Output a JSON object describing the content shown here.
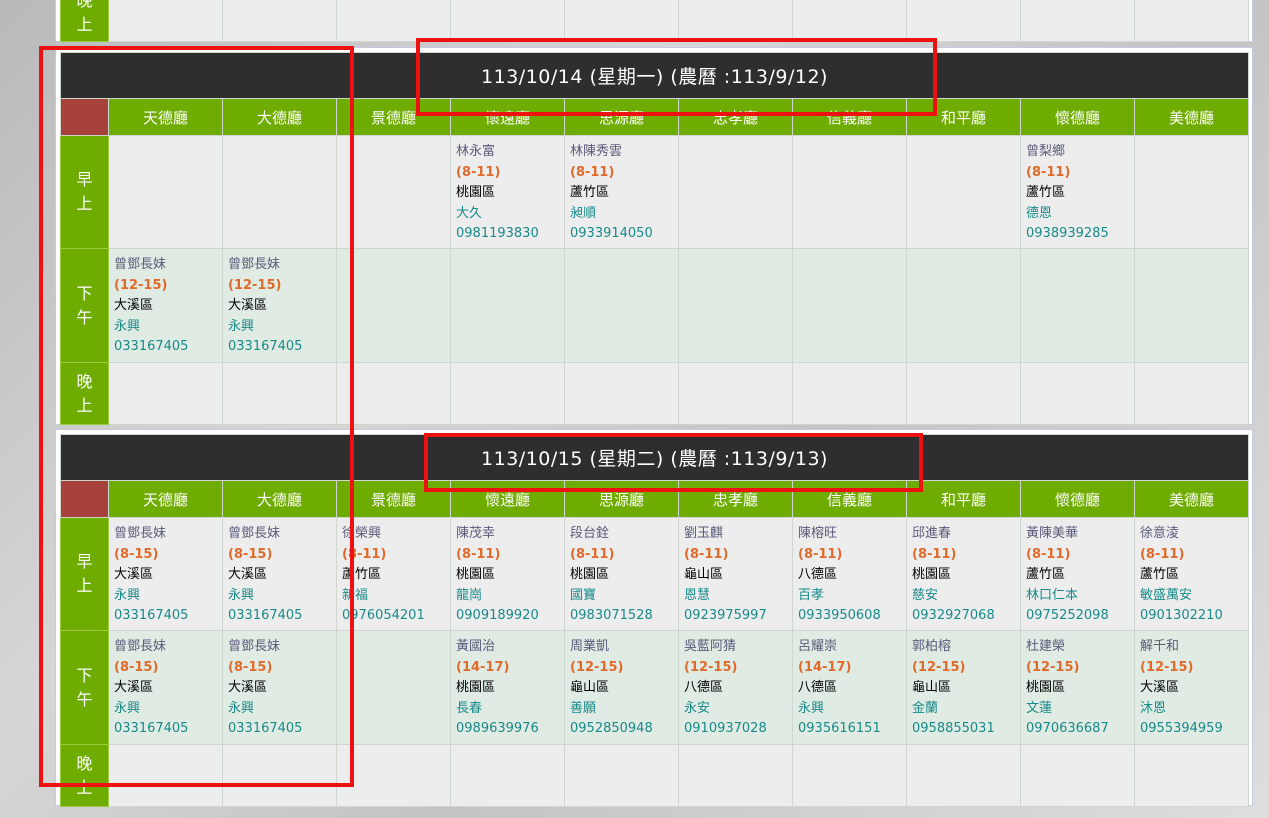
{
  "period_labels": {
    "am": [
      "早",
      "上"
    ],
    "pm": [
      "下",
      "午"
    ],
    "eve": [
      "晚",
      "上"
    ]
  },
  "top_fragment": {
    "period": [
      "晚",
      "上"
    ]
  },
  "days": [
    {
      "date_header": "113/10/14 (星期一) (農曆 :113/9/12)",
      "halls": [
        "天德廳",
        "大德廳",
        "景德廳",
        "懷遠廳",
        "思源廳",
        "忠孝廳",
        "信義廳",
        "和平廳",
        "懷德廳",
        "美德廳"
      ],
      "am": [
        null,
        null,
        null,
        {
          "name": "林永富",
          "time": "(8-11)",
          "district": "桃園區",
          "li": "大久",
          "phone": "0981193830"
        },
        {
          "name": "林陳秀雲",
          "time": "(8-11)",
          "district": "蘆竹區",
          "li": "昶順",
          "phone": "0933914050"
        },
        null,
        null,
        null,
        {
          "name": "曾梨鄉",
          "time": "(8-11)",
          "district": "蘆竹區",
          "li": "德恩",
          "phone": "0938939285"
        },
        null
      ],
      "pm": [
        {
          "name": "曾鄧長妹",
          "time": "(12-15)",
          "district": "大溪區",
          "li": "永興",
          "phone": "033167405"
        },
        {
          "name": "曾鄧長妹",
          "time": "(12-15)",
          "district": "大溪區",
          "li": "永興",
          "phone": "033167405"
        },
        null,
        null,
        null,
        null,
        null,
        null,
        null,
        null
      ],
      "eve": [
        null,
        null,
        null,
        null,
        null,
        null,
        null,
        null,
        null,
        null
      ]
    },
    {
      "date_header": "113/10/15 (星期二) (農曆 :113/9/13)",
      "halls": [
        "天德廳",
        "大德廳",
        "景德廳",
        "懷遠廳",
        "思源廳",
        "忠孝廳",
        "信義廳",
        "和平廳",
        "懷德廳",
        "美德廳"
      ],
      "am": [
        {
          "name": "曾鄧長妹",
          "time": "(8-15)",
          "district": "大溪區",
          "li": "永興",
          "phone": "033167405"
        },
        {
          "name": "曾鄧長妹",
          "time": "(8-15)",
          "district": "大溪區",
          "li": "永興",
          "phone": "033167405"
        },
        {
          "name": "徐榮興",
          "time": "(8-11)",
          "district": "蘆竹區",
          "li": "新福",
          "phone": "0976054201"
        },
        {
          "name": "陳茂幸",
          "time": "(8-11)",
          "district": "桃園區",
          "li": "龍崗",
          "phone": "0909189920"
        },
        {
          "name": "段台銓",
          "time": "(8-11)",
          "district": "桃園區",
          "li": "國寶",
          "phone": "0983071528"
        },
        {
          "name": "劉玉麒",
          "time": "(8-11)",
          "district": "龜山區",
          "li": "恩慧",
          "phone": "0923975997"
        },
        {
          "name": "陳榕旺",
          "time": "(8-11)",
          "district": "八德區",
          "li": "百孝",
          "phone": "0933950608"
        },
        {
          "name": "邱進春",
          "time": "(8-11)",
          "district": "桃園區",
          "li": "慈安",
          "phone": "0932927068"
        },
        {
          "name": "黃陳美華",
          "time": "(8-11)",
          "district": "蘆竹區",
          "li": "林口仁本",
          "phone": "0975252098"
        },
        {
          "name": "徐意淩",
          "time": "(8-11)",
          "district": "蘆竹區",
          "li": "敏盛萬安",
          "phone": "0901302210"
        }
      ],
      "pm": [
        {
          "name": "曾鄧長妹",
          "time": "(8-15)",
          "district": "大溪區",
          "li": "永興",
          "phone": "033167405"
        },
        {
          "name": "曾鄧長妹",
          "time": "(8-15)",
          "district": "大溪區",
          "li": "永興",
          "phone": "033167405"
        },
        null,
        {
          "name": "黃國治",
          "time": "(14-17)",
          "district": "桃園區",
          "li": "長春",
          "phone": "0989639976"
        },
        {
          "name": "周業凱",
          "time": "(12-15)",
          "district": "龜山區",
          "li": "善願",
          "phone": "0952850948"
        },
        {
          "name": "吳藍阿猜",
          "time": "(12-15)",
          "district": "八德區",
          "li": "永安",
          "phone": "0910937028"
        },
        {
          "name": "呂耀崇",
          "time": "(14-17)",
          "district": "八德區",
          "li": "永興",
          "phone": "0935616151"
        },
        {
          "name": "郭柏榕",
          "time": "(12-15)",
          "district": "龜山區",
          "li": "金蘭",
          "phone": "0958855031"
        },
        {
          "name": "杜建榮",
          "time": "(12-15)",
          "district": "桃園區",
          "li": "文蓮",
          "phone": "0970636687"
        },
        {
          "name": "解千和",
          "time": "(12-15)",
          "district": "大溪區",
          "li": "沐恩",
          "phone": "0955394959"
        }
      ],
      "eve": [
        null,
        null,
        null,
        null,
        null,
        null,
        null,
        null,
        null,
        null
      ]
    }
  ]
}
